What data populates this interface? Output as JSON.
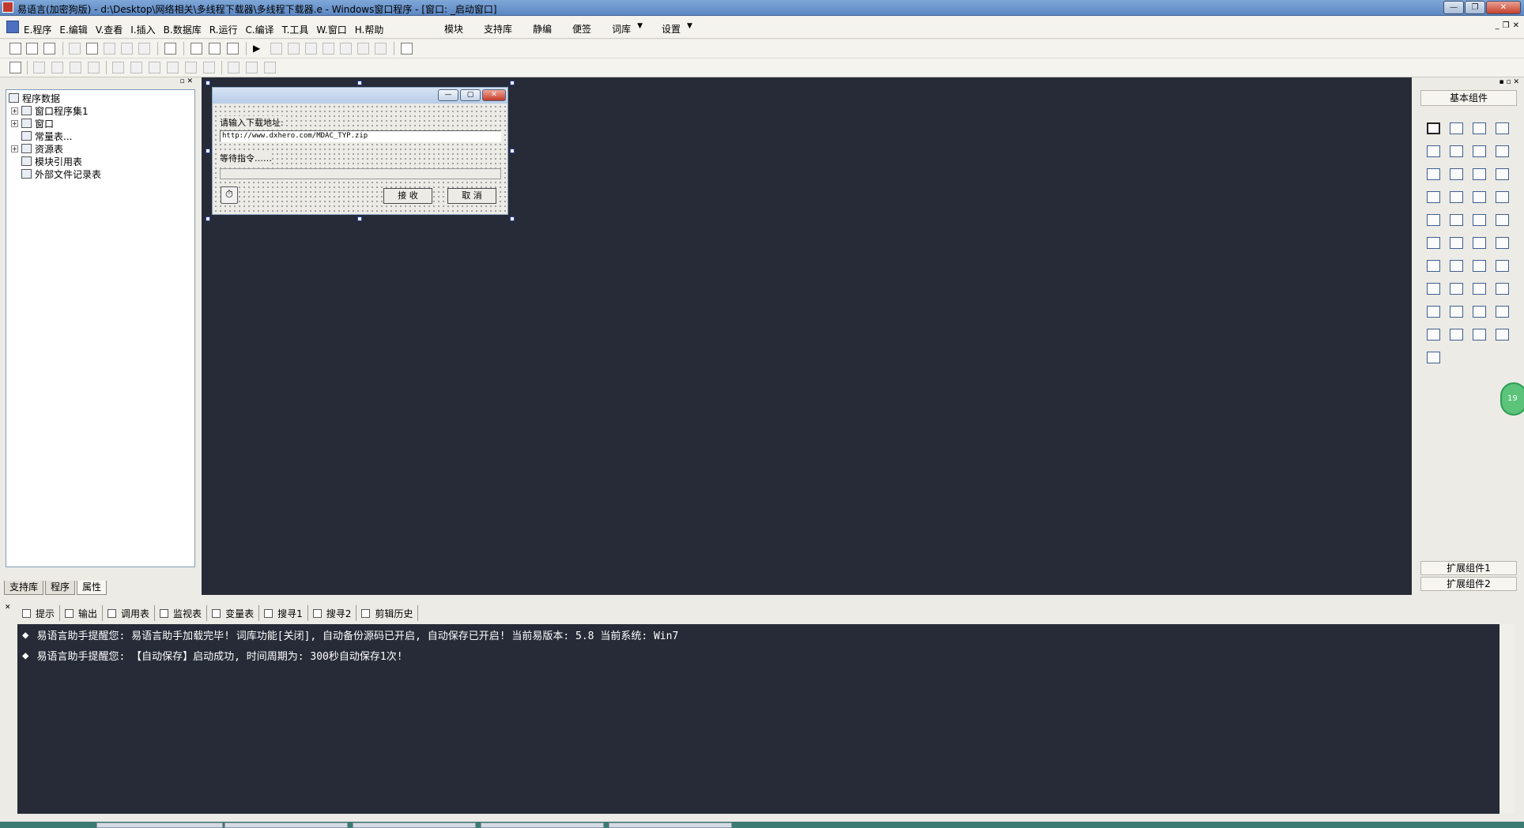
{
  "window": {
    "title": "易语言(加密狗版) - d:\\Desktop\\网络相关\\多线程下载器\\多线程下载器.e - Windows窗口程序 - [窗口: _启动窗口]",
    "controls": {
      "minimize": "—",
      "restore": "❐",
      "close": "✕"
    }
  },
  "menu": {
    "items": [
      "E.程序",
      "E.编辑",
      "V.查看",
      "I.插入",
      "B.数据库",
      "R.运行",
      "C.编译",
      "T.工具",
      "W.窗口",
      "H.帮助"
    ],
    "right_items": [
      "模块",
      "支持库",
      "静编",
      "便签",
      "词库",
      "设置"
    ],
    "mdi_controls": {
      "minimize": "_",
      "restore": "❐",
      "close": "✕"
    }
  },
  "project_panel": {
    "root": "程序数据",
    "nodes": [
      "窗口程序集1",
      "窗口",
      "常量表...",
      "资源表",
      "模块引用表",
      "外部文件记录表"
    ],
    "tabs": [
      "支持库",
      "程序",
      "属性"
    ],
    "head_controls": "▫ ✕"
  },
  "form": {
    "controls": {
      "minimize": "—",
      "restore": "▢",
      "close": "✕"
    },
    "url_label": "请输入下载地址:",
    "url_value": "http://www.dxhero.com/MDAC_TYP.zip",
    "status_label": "等待指令……",
    "accept_button": "接 收",
    "cancel_button": "取 消",
    "timer_icon": "⏱"
  },
  "palette": {
    "title": "基本组件",
    "ext1": "扩展组件1",
    "ext2": "扩展组件2",
    "head_controls": "▪ ▫ ✕",
    "badge": "19"
  },
  "bottom": {
    "tabs": [
      "提示",
      "输出",
      "调用表",
      "监视表",
      "变量表",
      "搜寻1",
      "搜寻2",
      "剪辑历史"
    ],
    "lines": [
      "易语言助手提醒您:  易语言助手加载完毕!  词库功能[关闭], 自动备份源码已开启, 自动保存已开启!  当前易版本: 5.8  当前系统: Win7",
      "易语言助手提醒您: 【自动保存】启动成功, 时间周期为: 300秒自动保存1次!"
    ],
    "bullet": "◆",
    "close_ctl": "✕"
  },
  "colors": {
    "titlebar": "#5c87c2",
    "workspace": "#262b37",
    "panel": "#ecebe6",
    "taskbar": "#3c7a74"
  }
}
